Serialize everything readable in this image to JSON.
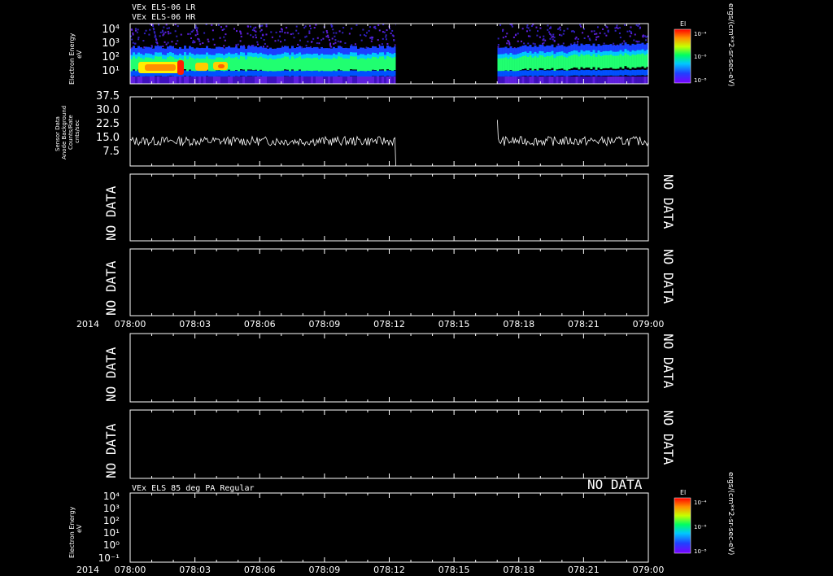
{
  "chart_data": [
    {
      "type": "heatmap",
      "title_lines": [
        "VEx ELS-06 LR",
        "VEx ELS-06 HR"
      ],
      "ylabel": [
        "Electron Energy",
        "eV"
      ],
      "yticks": [
        "10⁴",
        "10³",
        "10²",
        "10¹"
      ],
      "yscale": "log",
      "colorbar": {
        "label": "El",
        "units": "ergs/(cm**2-sr-sec-eV)",
        "ticks": [
          "10⁻⁴",
          "10⁻⁶",
          "10⁻⁸"
        ]
      },
      "data_gap": {
        "start": "078:12",
        "end": "078:17"
      }
    },
    {
      "type": "line",
      "ylabel": [
        "Sensor Data",
        "Anode Background",
        "Counts/Rate",
        "cnts/sec"
      ],
      "yticks": [
        "37.5",
        "30.0",
        "22.5",
        "15.0",
        "7.5"
      ],
      "ylim": [
        0,
        37.5
      ],
      "baseline": 13.5,
      "noise_amplitude": 2.5,
      "spike_before_gap": {
        "x": "078:12",
        "value": 0
      },
      "spike_after_gap": {
        "x": "078:17",
        "value": 25
      },
      "data_gap": {
        "start": "078:12",
        "end": "078:17"
      }
    },
    {
      "type": "line",
      "no_data_left": "NO DATA",
      "no_data_right": "NO DATA"
    },
    {
      "type": "line",
      "no_data_left": "NO DATA",
      "no_data_right": "NO DATA"
    },
    {
      "type": "line",
      "no_data_left": "NO DATA",
      "no_data_right": "NO DATA"
    },
    {
      "type": "line",
      "no_data_left": "NO DATA",
      "no_data_right": "NO DATA"
    },
    {
      "type": "heatmap",
      "title": "VEx ELS 85 deg PA Regular",
      "ylabel": [
        "Electron Energy",
        "eV"
      ],
      "yticks": [
        "10⁴",
        "10³",
        "10²",
        "10¹",
        "10⁰",
        "10⁻¹"
      ],
      "no_data": "NO DATA",
      "colorbar": {
        "label": "El",
        "units": "ergs/(cm**2-sr-sec-eV)",
        "ticks": [
          "10⁻⁴",
          "10⁻⁶",
          "10⁻⁸"
        ]
      }
    }
  ],
  "time_axis": {
    "year": "2014",
    "labels": [
      "078:00",
      "078:03",
      "078:06",
      "078:09",
      "078:12",
      "078:15",
      "078:18",
      "078:21",
      "079:00"
    ]
  }
}
